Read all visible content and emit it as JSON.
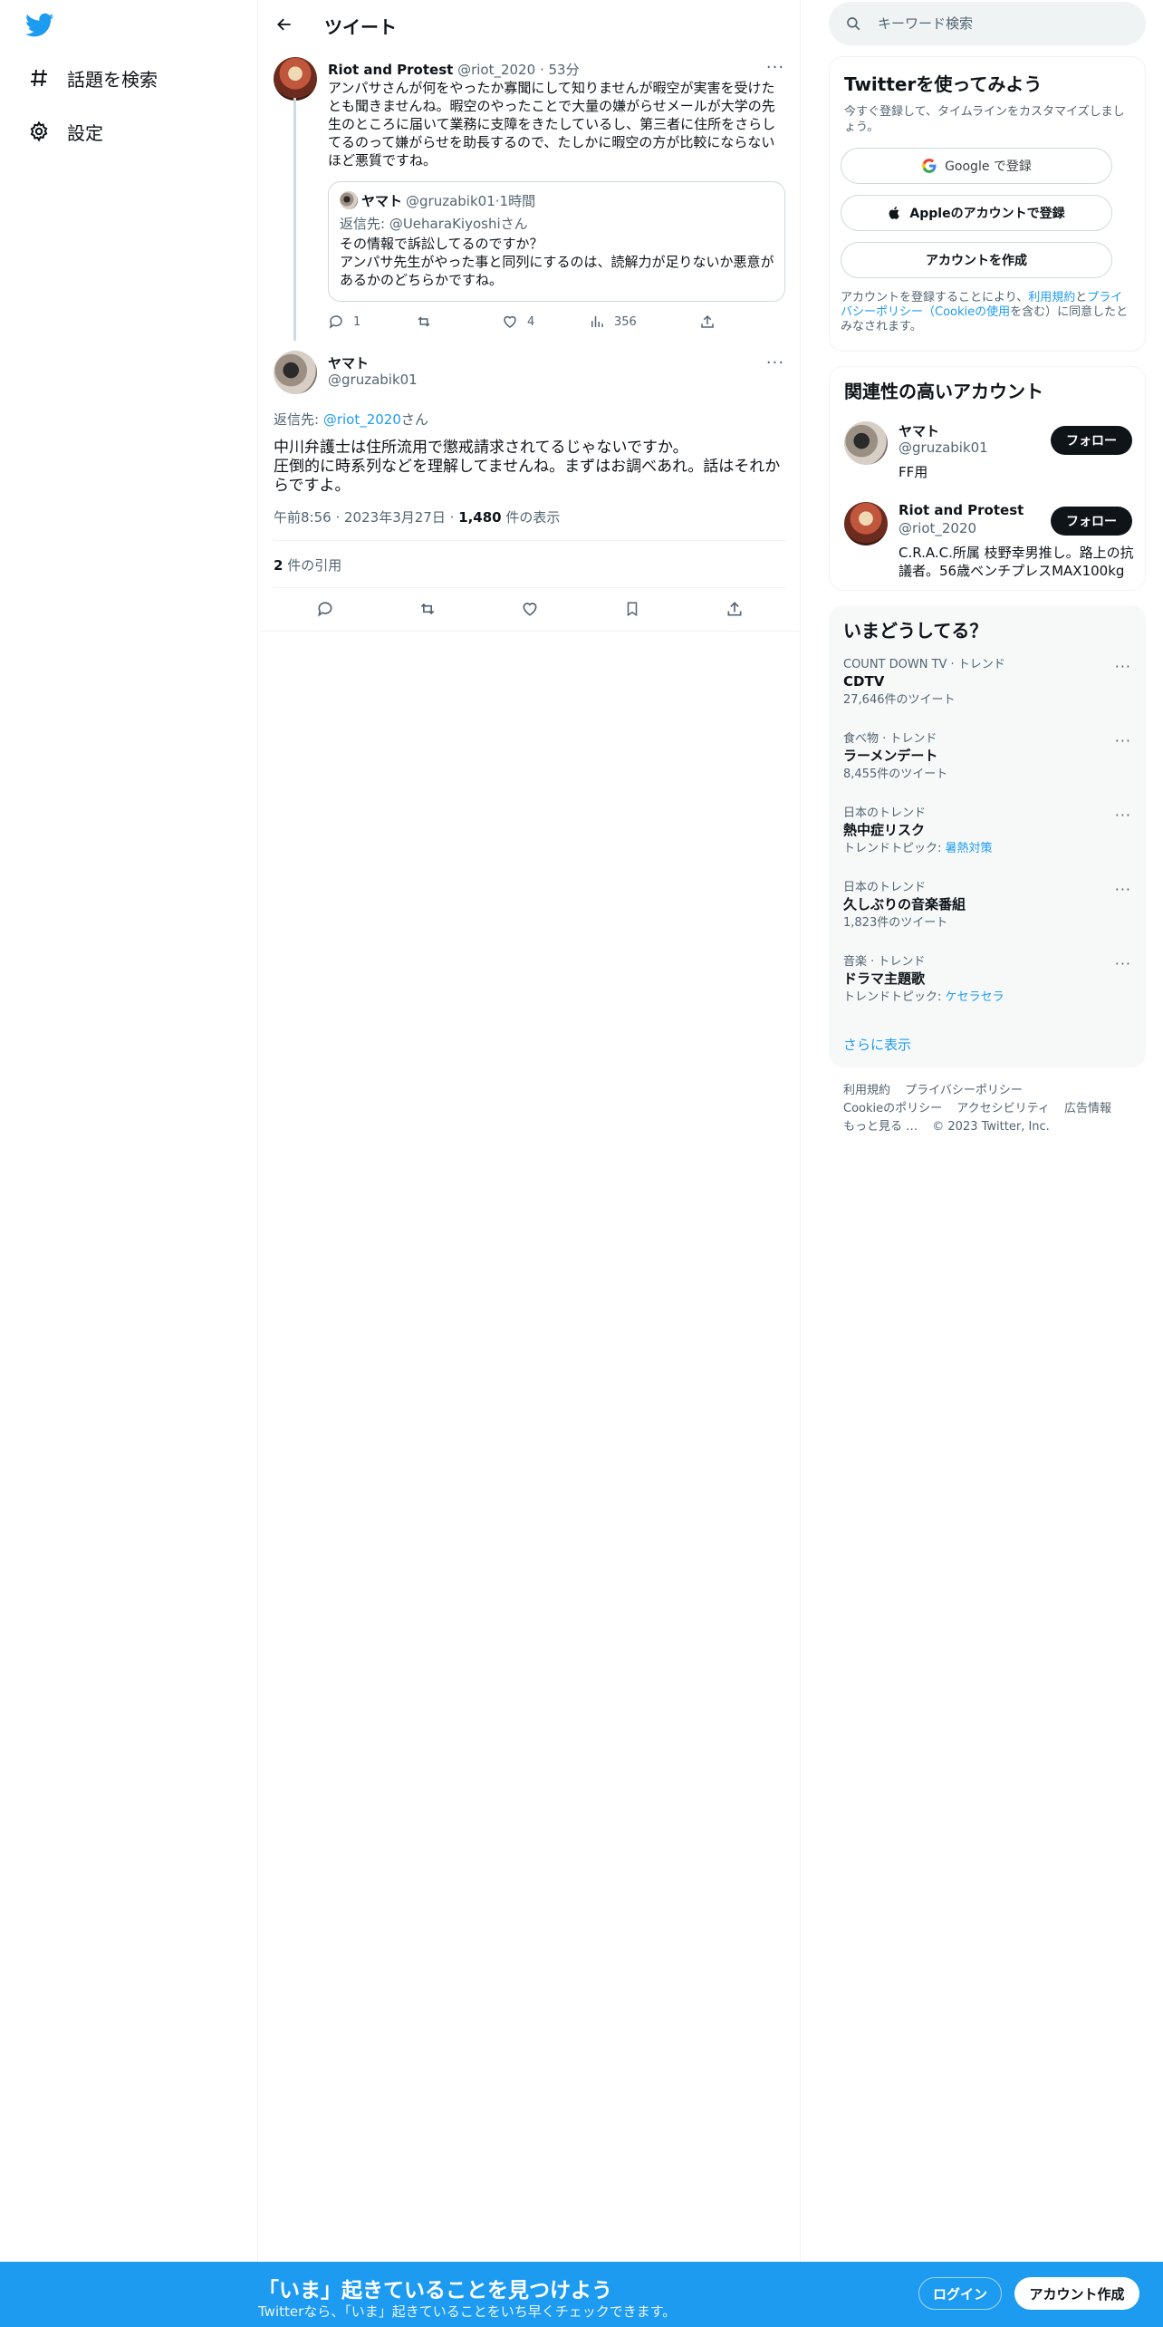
{
  "nav": {
    "items": [
      {
        "label": "話題を検索",
        "icon": "hashtag-icon"
      },
      {
        "label": "設定",
        "icon": "gear-icon"
      }
    ]
  },
  "header": {
    "title": "ツイート"
  },
  "tweet1": {
    "name": "Riot and Protest",
    "handle": "@riot_2020",
    "time": "53分",
    "text": "アンパサさんが何をやったか寡聞にして知りませんが暇空が実害を受けたとも聞きませんね。暇空のやったことで大量の嫌がらせメールが大学の先生のところに届いて業務に支障をきたしているし、第三者に住所をさらしてるのって嫌がらせを助長するので、たしかに暇空の方が比較にならないほど悪質ですね。",
    "quote": {
      "name": "ヤマト",
      "handle": "@gruzabik01",
      "time": "1時間",
      "reply_to": "返信先: @UeharaKiyoshiさん",
      "text_line1": "その情報で訴訟してるのですか？",
      "text_line2": "アンパサ先生がやった事と同列にするのは、読解力が足りないか悪意があるかのどちらかですね。"
    },
    "stats": {
      "replies": "1",
      "retweets": "",
      "likes": "4",
      "views": "356"
    }
  },
  "tweet2": {
    "name": "ヤマト",
    "handle": "@gruzabik01",
    "reply_prefix": "返信先: ",
    "reply_handle": "@riot_2020",
    "reply_suffix": "さん",
    "text_line1": "中川弁護士は住所流用で懲戒請求されてるじゃないですか。",
    "text_line2": "圧倒的に時系列などを理解してませんね。まずはお調べあれ。話はそれからですよ。",
    "time": "午前8:56",
    "date": "2023年3月27日",
    "views": "1,480",
    "views_label": "件の表示",
    "quotes_count": "2",
    "quotes_label": "件の引用"
  },
  "search": {
    "placeholder": "キーワード検索"
  },
  "signup_card": {
    "title": "Twitterを使ってみよう",
    "subtitle": "今すぐ登録して、タイムラインをカスタマイズしましょう。",
    "google_label": "Google で登録",
    "apple_label": "Appleのアカウントで登録",
    "create_label": "アカウントを作成",
    "terms_prefix": "アカウントを登録することにより、",
    "terms_link1": "利用規約",
    "terms_and": "と",
    "terms_link2": "プライバシーポリシー",
    "terms_paren_open": "（",
    "terms_link3": "Cookieの使用",
    "terms_suffix": "を含む）に同意したとみなされます。"
  },
  "related": {
    "title": "関連性の高いアカウント",
    "follow_label": "フォロー",
    "accounts": [
      {
        "name": "ヤマト",
        "handle": "@gruzabik01",
        "bio": "FF用"
      },
      {
        "name": "Riot and Protest",
        "handle": "@riot_2020",
        "bio": "C.R.A.C.所属 枝野幸男推し。路上の抗議者。56歳ベンチプレスMAX100kg"
      }
    ]
  },
  "trends": {
    "title": "いまどうしてる？",
    "items": [
      {
        "meta": "COUNT DOWN TV · トレンド",
        "name": "CDTV",
        "sub": "27,646件のツイート",
        "sub_link": ""
      },
      {
        "meta": "食べ物 · トレンド",
        "name": "ラーメンデート",
        "sub": "8,455件のツイート",
        "sub_link": ""
      },
      {
        "meta": "日本のトレンド",
        "name": "熱中症リスク",
        "sub": "トレンドトピック: ",
        "sub_link": "暑熱対策"
      },
      {
        "meta": "日本のトレンド",
        "name": "久しぶりの音楽番組",
        "sub": "1,823件のツイート",
        "sub_link": ""
      },
      {
        "meta": "音楽 · トレンド",
        "name": "ドラマ主題歌",
        "sub": "トレンドトピック: ",
        "sub_link": "ケセラセラ"
      }
    ],
    "show_more": "さらに表示"
  },
  "footer": {
    "links": [
      "利用規約",
      "プライバシーポリシー",
      "Cookieのポリシー",
      "アクセシビリティ",
      "広告情報",
      "もっと見る …"
    ],
    "copyright": "© 2023 Twitter, Inc."
  },
  "bottom_bar": {
    "title": "「いま」起きていることを見つけよう",
    "subtitle": "Twitterなら、「いま」起きていることをいち早くチェックできます。",
    "login_label": "ログイン",
    "signup_label": "アカウント作成"
  },
  "colors": {
    "brand": "#1d9bf0",
    "text": "#0f1419",
    "muted": "#536471"
  }
}
